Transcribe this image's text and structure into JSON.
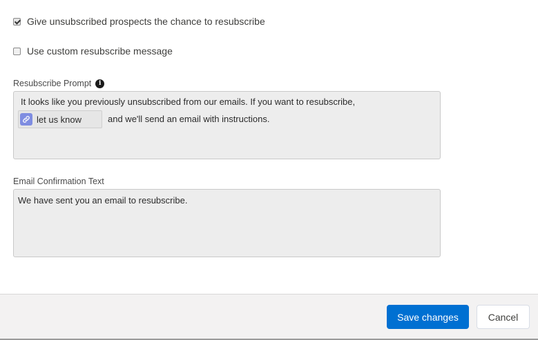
{
  "options": {
    "give_chance": {
      "label": "Give unsubscribed prospects the chance to resubscribe",
      "checked": true
    },
    "custom_message": {
      "label": "Use custom resubscribe message",
      "checked": false
    }
  },
  "resubscribe_prompt": {
    "label": "Resubscribe Prompt",
    "info_icon": "info-icon",
    "text_before": "It looks like you previously unsubscribed from our emails. If you want to resubscribe,",
    "link_label": "let us know",
    "link_icon": "link-icon",
    "text_after": "and we'll send an email with instructions."
  },
  "email_confirmation": {
    "label": "Email Confirmation Text",
    "text": "We have sent you an email to resubscribe."
  },
  "footer": {
    "save_label": "Save changes",
    "cancel_label": "Cancel"
  },
  "colors": {
    "primary": "#0070d2",
    "link_icon_bg": "#7f8de1",
    "field_bg": "#ededed"
  }
}
